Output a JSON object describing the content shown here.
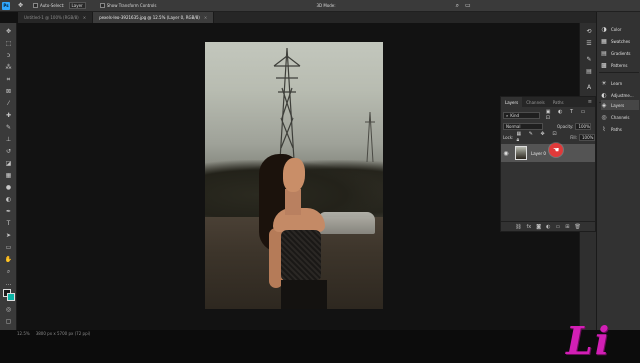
{
  "app": {
    "name": "Ps"
  },
  "options_bar": {
    "auto_select_label": "Auto-Select:",
    "auto_select_value": "Layer",
    "show_transform_label": "Show Transform Controls",
    "mode_label": "3D Mode:"
  },
  "tabs": [
    {
      "label": "Untitled-1 @ 100% (RGB/8)",
      "active": false
    },
    {
      "label": "pexels-leo-3921635.jpg @ 12.5% (Layer 0, RGB/8)",
      "active": true
    }
  ],
  "right_panel": {
    "items": [
      {
        "label": "Color",
        "icon": "color-icon"
      },
      {
        "label": "Swatches",
        "icon": "swatches-icon"
      },
      {
        "label": "Gradients",
        "icon": "gradients-icon"
      },
      {
        "label": "Patterns",
        "icon": "patterns-icon"
      },
      {
        "label": "Learn",
        "icon": "learn-icon"
      },
      {
        "label": "Adjustme...",
        "icon": "adjustments-icon"
      },
      {
        "label": "Layers",
        "icon": "layers-icon",
        "active": true
      },
      {
        "label": "Channels",
        "icon": "channels-icon"
      },
      {
        "label": "Paths",
        "icon": "paths-icon"
      }
    ]
  },
  "layers_panel": {
    "tabs": [
      "Layers",
      "Channels",
      "Paths"
    ],
    "active_tab": "Layers",
    "filter_label": "Kind",
    "blend_mode": "Normal",
    "opacity_label": "Opacity:",
    "opacity_value": "100%",
    "lock_label": "Lock:",
    "fill_label": "Fill:",
    "fill_value": "100%",
    "layer_name": "Layer 0"
  },
  "status_bar": {
    "zoom": "12.5%",
    "doc_info": "3800 px x 5700 px (72 ppi)"
  },
  "watermark": "Li",
  "colors": {
    "accent": "#31a8ff",
    "cursor_highlight": "#e03a3a",
    "watermark": "#d21fb5"
  }
}
